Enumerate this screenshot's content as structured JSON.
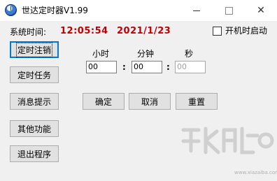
{
  "window": {
    "title": "世达定时器V1.99",
    "controls": {
      "minimize": "—",
      "maximize": "□",
      "close": "✕"
    }
  },
  "status": {
    "system_time_label": "系统时间:",
    "time": "12:05:54",
    "date": "2021/1/23",
    "startup_label": "开机时启动",
    "startup_checked": false
  },
  "sidebar": {
    "items": [
      {
        "label": "定时注销",
        "active": true
      },
      {
        "label": "定时任务",
        "active": false
      },
      {
        "label": "消息提示",
        "active": false
      },
      {
        "label": "其他功能",
        "active": false
      },
      {
        "label": "退出程序",
        "active": false
      }
    ]
  },
  "timer": {
    "hours_label": "小时",
    "minutes_label": "分钟",
    "seconds_label": "秒",
    "hours_value": "00",
    "minutes_value": "00",
    "seconds_value": "00",
    "separator": ":"
  },
  "actions": {
    "confirm": "确定",
    "cancel": "取消",
    "reset": "重置"
  },
  "watermark": {
    "text": "www.xiazaiba.com"
  },
  "colors": {
    "time_color": "#c00000",
    "window_bg": "#f0f0f0",
    "active_border": "#0078d7"
  }
}
